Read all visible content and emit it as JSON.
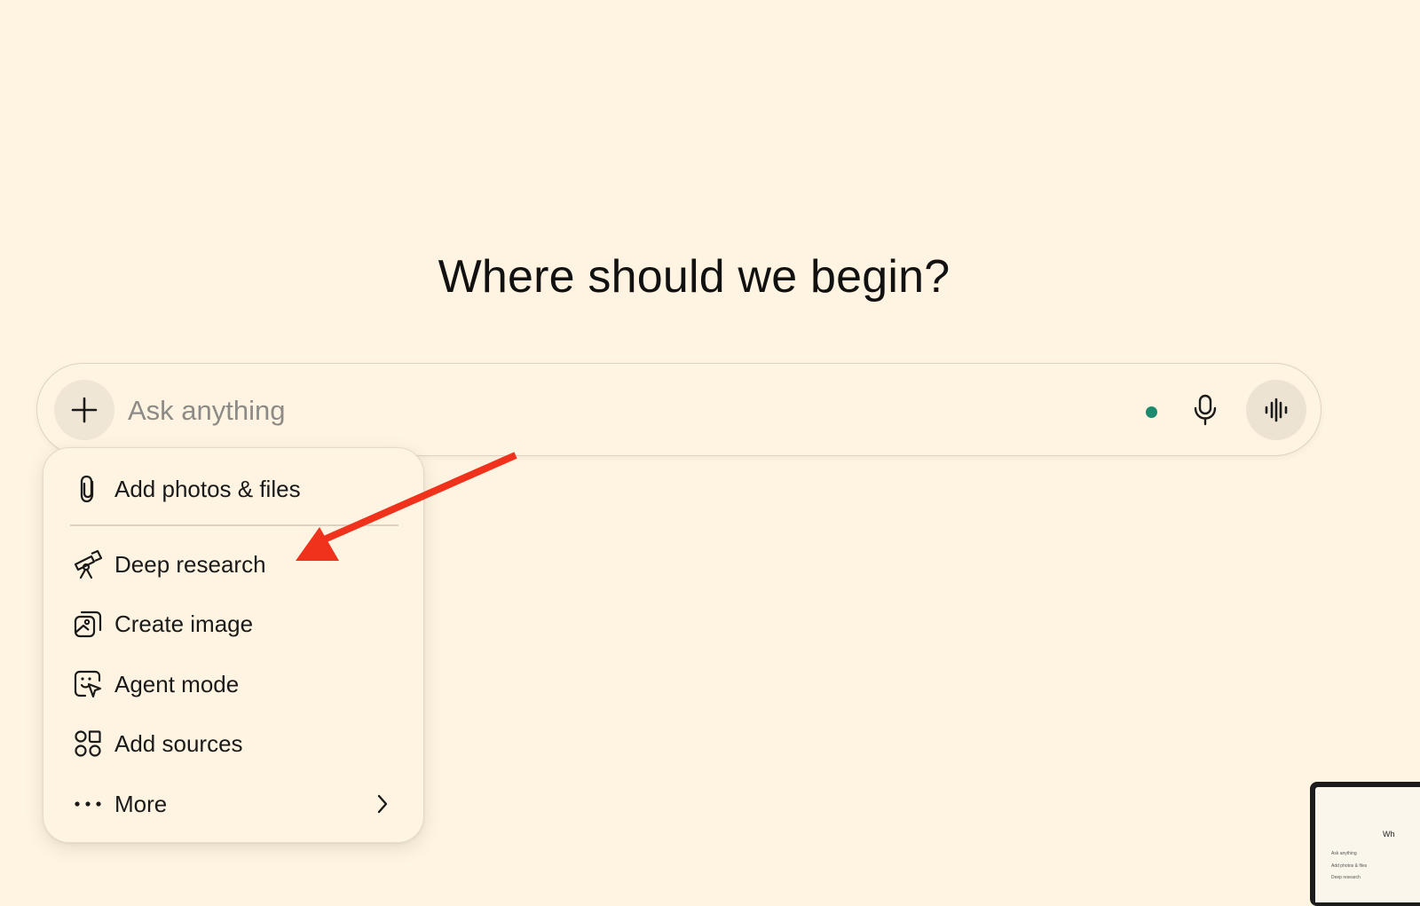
{
  "heading": "Where should we begin?",
  "composer": {
    "placeholder": "Ask anything",
    "status_color": "#1d8a6f"
  },
  "menu": {
    "items": [
      {
        "label": "Add photos & files",
        "icon": "paperclip-icon"
      },
      {
        "label": "Deep research",
        "icon": "telescope-icon"
      },
      {
        "label": "Create image",
        "icon": "image-create-icon"
      },
      {
        "label": "Agent mode",
        "icon": "agent-cursor-icon"
      },
      {
        "label": "Add sources",
        "icon": "sources-icon"
      },
      {
        "label": "More",
        "icon": "ellipsis-icon",
        "has_submenu": true
      }
    ]
  },
  "annotation": {
    "arrow_color": "#f0311c",
    "target": "Deep research"
  },
  "thumbnail": {
    "heading_fragment": "Wh",
    "lines": [
      "Ask anything",
      "Add photos & files",
      "Deep research"
    ]
  },
  "colors": {
    "background": "#fff4e1",
    "accent_dot": "#1d8a6f",
    "arrow": "#f0311c"
  }
}
